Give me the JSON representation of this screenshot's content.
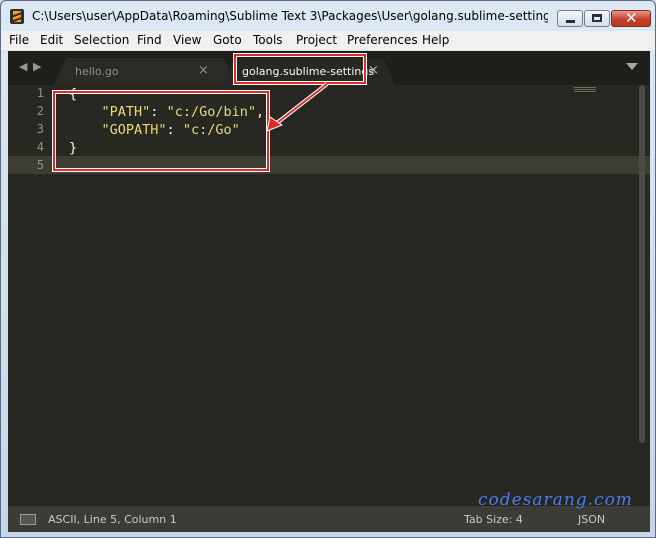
{
  "window": {
    "title": "C:\\Users\\user\\AppData\\Roaming\\Sublime Text 3\\Packages\\User\\golang.sublime-settings - Subl...",
    "minimize_glyph": "—",
    "maximize_glyph": "□",
    "close_glyph": "✕"
  },
  "menu": [
    "File",
    "Edit",
    "Selection",
    "Find",
    "View",
    "Goto",
    "Tools",
    "Project",
    "Preferences",
    "Help"
  ],
  "tabs": [
    {
      "label": "hello.go",
      "close": "×",
      "active": false
    },
    {
      "label": "golang.sublime-settings",
      "close": "×",
      "active": true
    }
  ],
  "nav": {
    "back": "◀",
    "forward": "▶"
  },
  "editor": {
    "line_numbers": [
      "1",
      "2",
      "3",
      "4",
      "5"
    ],
    "lines": [
      [
        {
          "t": "{",
          "c": "punc"
        }
      ],
      [
        {
          "t": "    ",
          "c": "punc"
        },
        {
          "t": "\"PATH\"",
          "c": "str"
        },
        {
          "t": ": ",
          "c": "punc"
        },
        {
          "t": "\"c:/Go/bin\"",
          "c": "str"
        },
        {
          "t": ",",
          "c": "punc"
        }
      ],
      [
        {
          "t": "    ",
          "c": "punc"
        },
        {
          "t": "\"GOPATH\"",
          "c": "str"
        },
        {
          "t": ": ",
          "c": "punc"
        },
        {
          "t": "\"c:/Go\"",
          "c": "str"
        }
      ],
      [
        {
          "t": "}",
          "c": "punc"
        }
      ],
      [
        {
          "t": "",
          "c": "punc"
        }
      ]
    ]
  },
  "status": {
    "position": "ASCII, Line 5, Column 1",
    "tab_size": "Tab Size: 4",
    "syntax": "JSON"
  },
  "watermark": "codesarang.com",
  "colors": {
    "background": "#272822",
    "string": "#e6db74",
    "annotation": "#e02a2a"
  }
}
